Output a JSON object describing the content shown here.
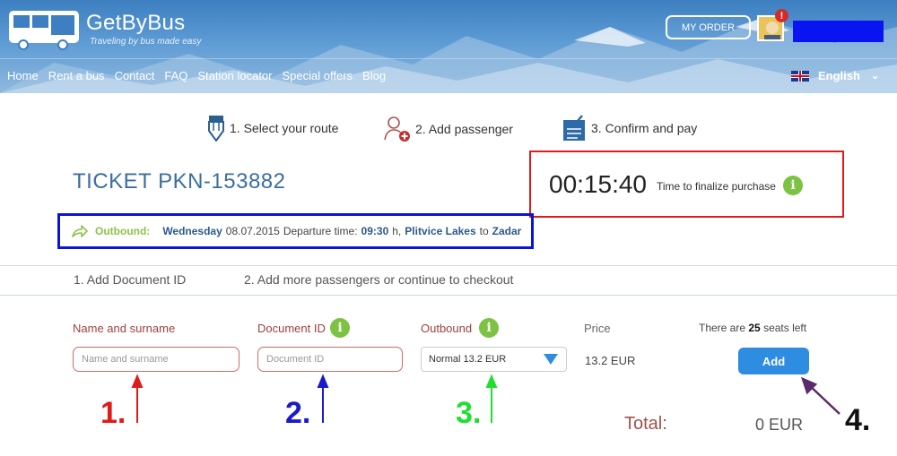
{
  "header": {
    "brand": "GetByBus",
    "tagline": "Traveling by bus made easy",
    "my_order_label": "MY ORDER",
    "alert_badge": "!",
    "nav": [
      "Home",
      "Rent a bus",
      "Contact",
      "FAQ",
      "Station locator",
      "Special offers",
      "Blog"
    ],
    "language": "English",
    "colors": {
      "header_blue": "#3d7fc0",
      "redaction_box": "#0a14f0"
    }
  },
  "steps": [
    {
      "label": "1. Select your route",
      "icon": "pencil-icon"
    },
    {
      "label": "2. Add passenger",
      "icon": "add-person-icon"
    },
    {
      "label": "3. Confirm and pay",
      "icon": "checklist-icon"
    }
  ],
  "ticket": {
    "title": "TICKET PKN-153882",
    "timer": "00:15:40",
    "timer_label": "Time to finalize purchase",
    "info_glyph": "i"
  },
  "outbound": {
    "label": "Outbound:",
    "day": "Wednesday",
    "date": "08.07.2015",
    "departure_label": "Departure time:",
    "time": "09:30",
    "time_suffix": "h,",
    "from": "Plitvice Lakes",
    "to_word": "to",
    "to": "Zadar"
  },
  "substeps": [
    "1. Add Document ID",
    "2. Add more passengers or continue to checkout"
  ],
  "form": {
    "name_label": "Name and surname",
    "name_placeholder": "Name and surname",
    "doc_label": "Document ID",
    "doc_placeholder": "Document ID",
    "outbound_label": "Outbound",
    "outbound_selected": "Normal 13.2 EUR",
    "price_label": "Price",
    "price_value": "13.2 EUR",
    "seats_prefix": "There are",
    "seats_count": "25",
    "seats_suffix": "seats left",
    "add_label": "Add"
  },
  "annotations": {
    "one": "1.",
    "two": "2.",
    "three": "3.",
    "four": "4.",
    "colors": {
      "one": "#e01b1b",
      "two": "#1a1acc",
      "three": "#22dd33",
      "four": "#111111",
      "arrow4": "#5a2a6a"
    }
  },
  "total": {
    "label": "Total:",
    "value": "0 EUR"
  }
}
